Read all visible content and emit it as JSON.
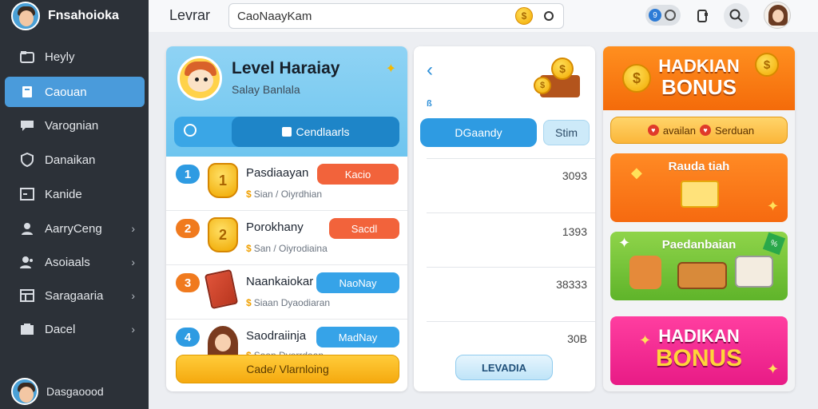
{
  "sidebar": {
    "brand": "Fnsahoioka",
    "items": [
      {
        "label": "Heyly",
        "icon": "folder-icon",
        "chevron": false,
        "active": false
      },
      {
        "label": "Caouan",
        "icon": "book-icon",
        "chevron": false,
        "active": true
      },
      {
        "label": "Varognian",
        "icon": "chat-icon",
        "chevron": false,
        "active": false
      },
      {
        "label": "Danaikan",
        "icon": "shield-icon",
        "chevron": false,
        "active": false
      },
      {
        "label": "Kanide",
        "icon": "calendar-icon",
        "chevron": false,
        "active": false
      },
      {
        "label": "AarryCeng",
        "icon": "user-icon",
        "chevron": true,
        "active": false
      },
      {
        "label": "Asoiaals",
        "icon": "users-icon",
        "chevron": true,
        "active": false
      },
      {
        "label": "Saragaaria",
        "icon": "table-icon",
        "chevron": true,
        "active": false
      },
      {
        "label": "Dacel",
        "icon": "inbox-icon",
        "chevron": true,
        "active": false
      }
    ],
    "footer_user": "Dasgaoood"
  },
  "topbar": {
    "title": "Levrar",
    "search_value": "CaoNaayKam",
    "coin_symbol": "$"
  },
  "leaderboard": {
    "title": "Level Haraiay",
    "subtitle": "Salay Banlala",
    "search_button": "Cendlaarls",
    "rows": [
      {
        "rank": "1",
        "name": "Pasdiaayan",
        "meta": "Sian / Oiyrdhian",
        "tag": "Kacio",
        "tag_color": "orange",
        "art": "trophy"
      },
      {
        "rank": "2",
        "name": "Porokhany",
        "meta": "San / Oiyrodiaina",
        "tag": "Sacdl",
        "tag_color": "orange",
        "art": "trophy"
      },
      {
        "rank": "3",
        "name": "Naankaiokar",
        "meta": "Siaan Dyaodiaran",
        "tag": "NaoNay",
        "tag_color": "blue",
        "art": "card"
      },
      {
        "rank": "4",
        "name": "Saodraiinja",
        "meta": "Saan Dyorrdaan",
        "tag": "MadNay",
        "tag_color": "blue",
        "art": "girl"
      }
    ],
    "cta": "Cade/ Vlarnloing"
  },
  "stats": {
    "small_label": "ß",
    "primary_button": "DGaandy",
    "secondary_button": "Stim",
    "values": [
      "3093",
      "1393",
      "38333",
      "30B"
    ],
    "cta": "LEVADIA"
  },
  "promos": {
    "banner_line1": "HADKIAN",
    "banner_line2": "BONUS",
    "pill_left": "availan",
    "pill_right": "Serduan",
    "tile1_label": "Rauda tiah",
    "tile2_label": "Paedanbaian",
    "tile3_line1": "HADIKAN",
    "tile3_line2": "BONUS"
  },
  "colors": {
    "sidebar_bg": "#2c3138",
    "accent_blue": "#4a9bdb",
    "orange": "#f46b0a",
    "gold": "#f5a90f"
  }
}
